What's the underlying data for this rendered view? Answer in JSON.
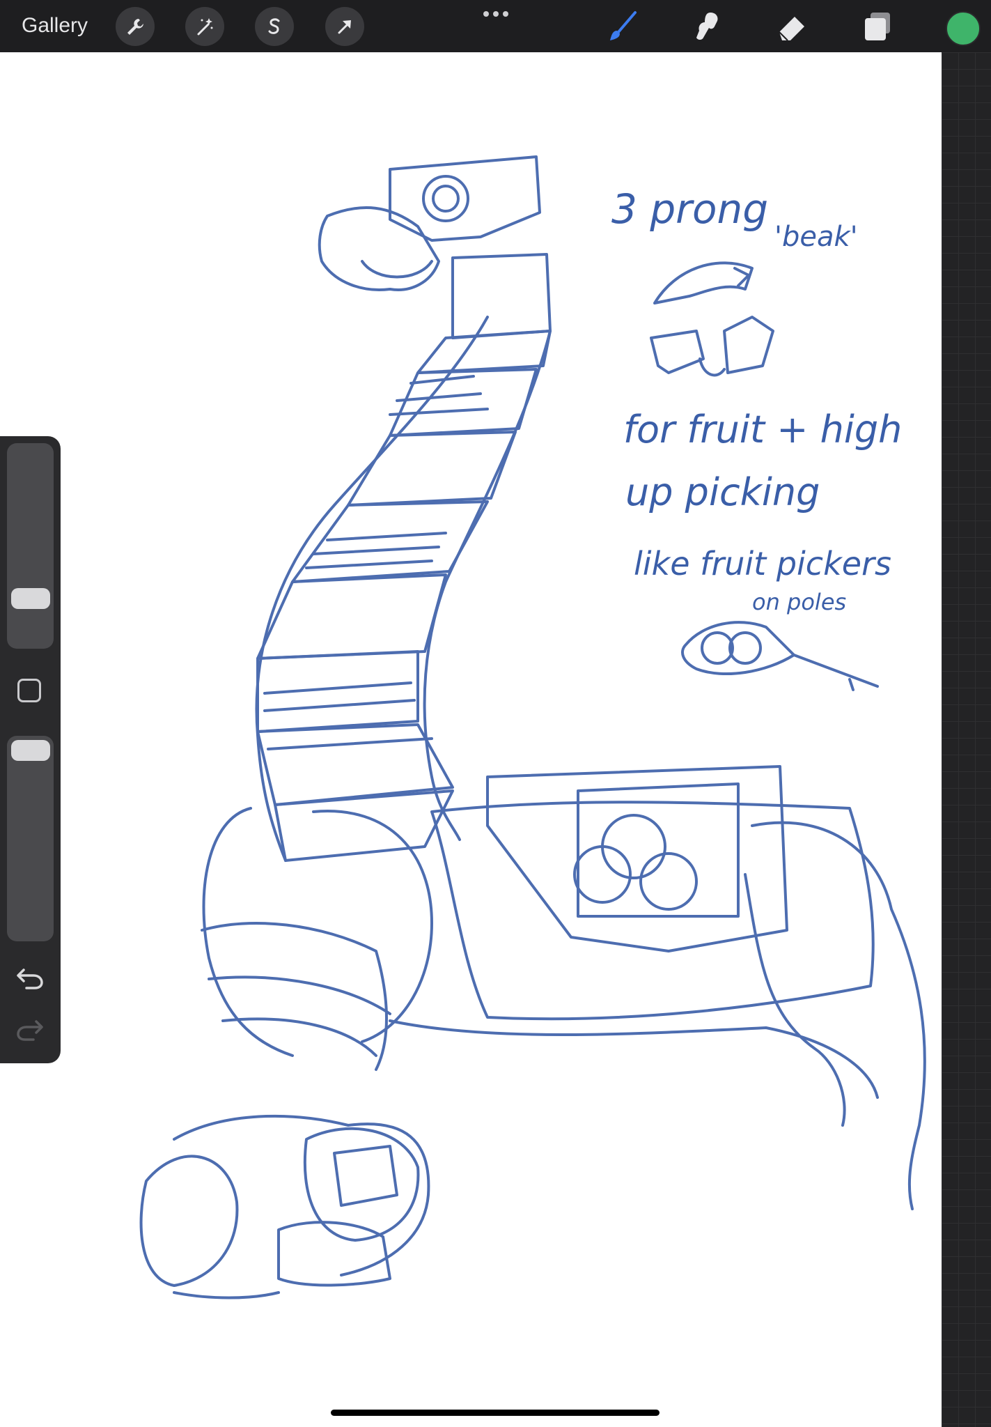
{
  "toolbar": {
    "gallery_label": "Gallery",
    "left_tools": [
      "wrench-icon",
      "magic-wand-icon",
      "selection-s-icon",
      "transform-arrow-icon"
    ],
    "right_tools": [
      "brush-icon",
      "smudge-icon",
      "eraser-icon",
      "layers-icon"
    ],
    "active_tool": "brush-icon",
    "current_color": "#3fb46a"
  },
  "sidebar": {
    "brush_size_level": 0.72,
    "opacity_level": 0.05
  },
  "sketch": {
    "ink_color": "#3a5ea8",
    "notes": [
      "3 prong",
      "'beak'",
      "for fruit + high",
      "up picking",
      "like fruit pickers",
      "on poles"
    ]
  }
}
